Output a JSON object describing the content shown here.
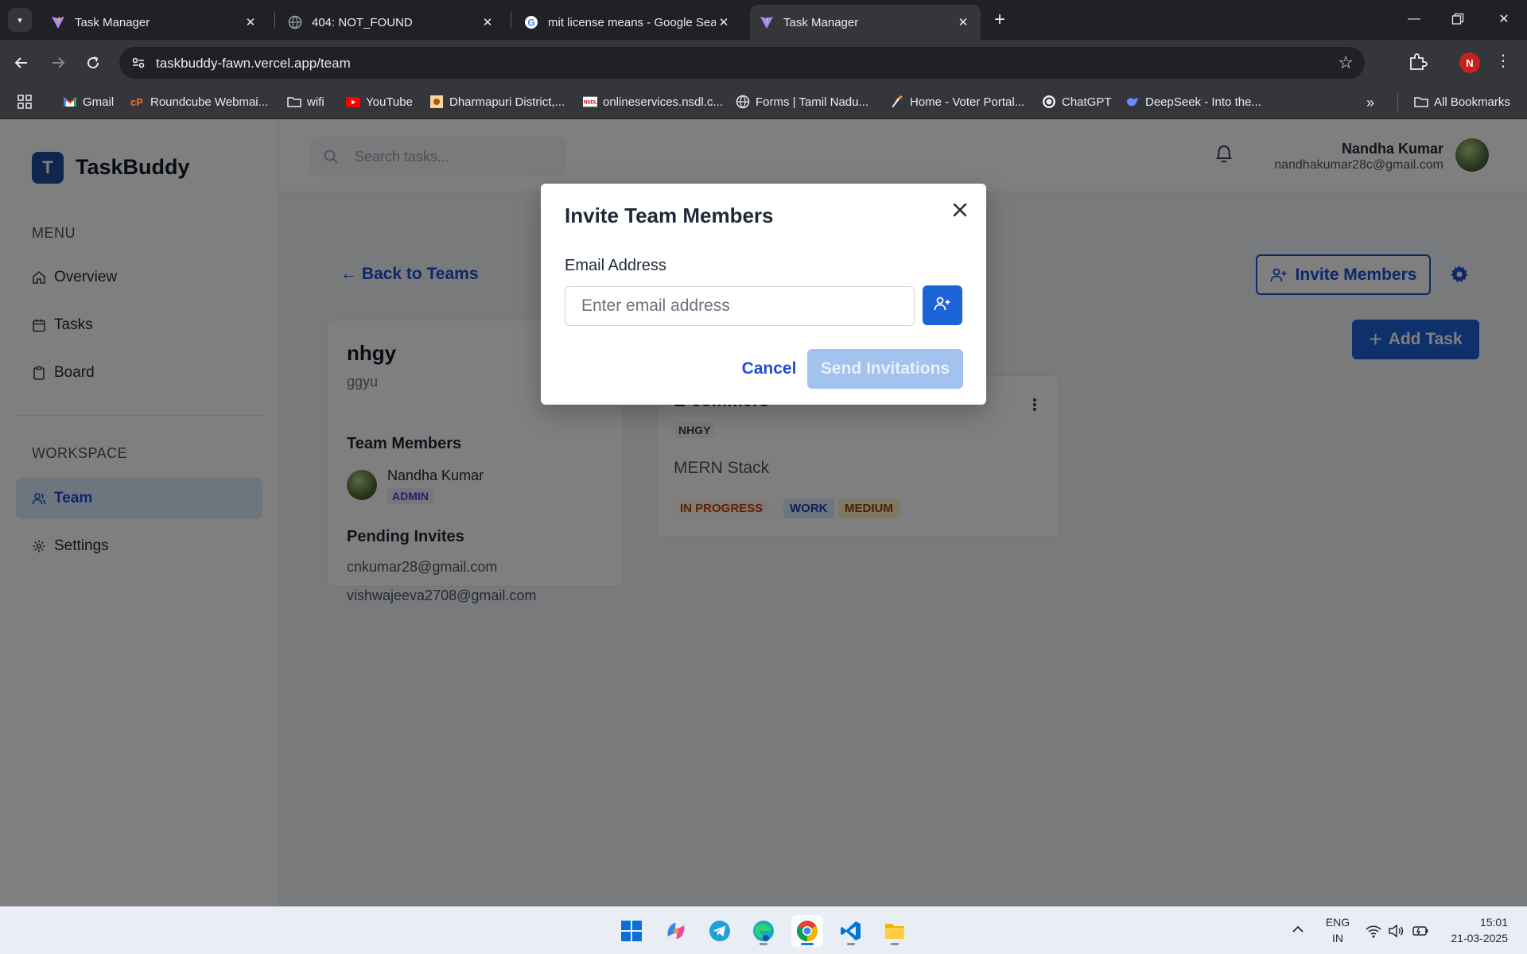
{
  "browser": {
    "tabs": [
      {
        "title": "Task Manager",
        "active": false
      },
      {
        "title": "404: NOT_FOUND",
        "active": false
      },
      {
        "title": "mit license means - Google Sea",
        "active": false
      },
      {
        "title": "Task Manager",
        "active": true
      }
    ],
    "url": "taskbuddy-fawn.vercel.app/team",
    "profile_initial": "N",
    "bookmarks": [
      {
        "label": "Gmail",
        "icon": "gmail-icon"
      },
      {
        "label": "Roundcube Webmai...",
        "icon": "cpanel-icon"
      },
      {
        "label": "wifi",
        "icon": "folder-icon"
      },
      {
        "label": "YouTube",
        "icon": "youtube-icon"
      },
      {
        "label": "Dharmapuri District,...",
        "icon": "site-icon"
      },
      {
        "label": "onlineservices.nsdl.c...",
        "icon": "nsdl-icon"
      },
      {
        "label": "Forms | Tamil Nadu...",
        "icon": "globe-icon"
      },
      {
        "label": "Home - Voter Portal...",
        "icon": "voter-icon"
      },
      {
        "label": "ChatGPT",
        "icon": "chatgpt-icon"
      },
      {
        "label": "DeepSeek - Into the...",
        "icon": "deepseek-icon"
      }
    ],
    "all_bookmarks": "All Bookmarks"
  },
  "app": {
    "brand": {
      "logo_letter": "T",
      "name": "TaskBuddy"
    },
    "menu_label": "MENU",
    "menu": [
      {
        "label": "Overview",
        "icon": "home-icon"
      },
      {
        "label": "Tasks",
        "icon": "calendar-icon"
      },
      {
        "label": "Board",
        "icon": "clipboard-icon"
      }
    ],
    "workspace_label": "WORKSPACE",
    "workspace": [
      {
        "label": "Team",
        "icon": "users-icon",
        "active": true
      },
      {
        "label": "Settings",
        "icon": "gear-icon",
        "active": false
      }
    ],
    "search_placeholder": "Search tasks...",
    "user": {
      "name": "Nandha Kumar",
      "email": "nandhakumar28c@gmail.com"
    },
    "back_label": "← Back to Teams",
    "invite_members_label": "Invite Members",
    "add_task_label": "Add Task",
    "team": {
      "name": "nhgy",
      "description": "ggyu",
      "members_heading": "Team Members",
      "members": [
        {
          "name": "Nandha Kumar",
          "role": "ADMIN"
        }
      ],
      "pending_heading": "Pending Invites",
      "pending": [
        "cnkumar28@gmail.com",
        "vishwajeeva2708@gmail.com"
      ]
    },
    "task": {
      "title": "E-commers",
      "team_tag": "NHGY",
      "description": "MERN Stack",
      "tags": [
        {
          "label": "IN PROGRESS",
          "bg": "#fff7ed",
          "color": "#c2410c"
        },
        {
          "label": "WORK",
          "bg": "#dbeafe",
          "color": "#1e40af"
        },
        {
          "label": "MEDIUM",
          "bg": "#fef3c7",
          "color": "#92400e"
        }
      ]
    }
  },
  "modal": {
    "title": "Invite Team Members",
    "email_label": "Email Address",
    "email_placeholder": "Enter email address",
    "email_value": "",
    "cancel_label": "Cancel",
    "send_label": "Send Invitations"
  },
  "taskbar": {
    "apps": [
      "windows-start-icon",
      "copilot-icon",
      "telegram-icon",
      "edge-icon",
      "chrome-icon",
      "vscode-icon",
      "file-explorer-icon"
    ],
    "lang_top": "ENG",
    "lang_bottom": "IN",
    "time": "15:01",
    "date": "21-03-2025"
  },
  "colors": {
    "accent": "#1d63d8",
    "brand": "#1f4e9c",
    "admin_badge": "#ede9fe"
  }
}
